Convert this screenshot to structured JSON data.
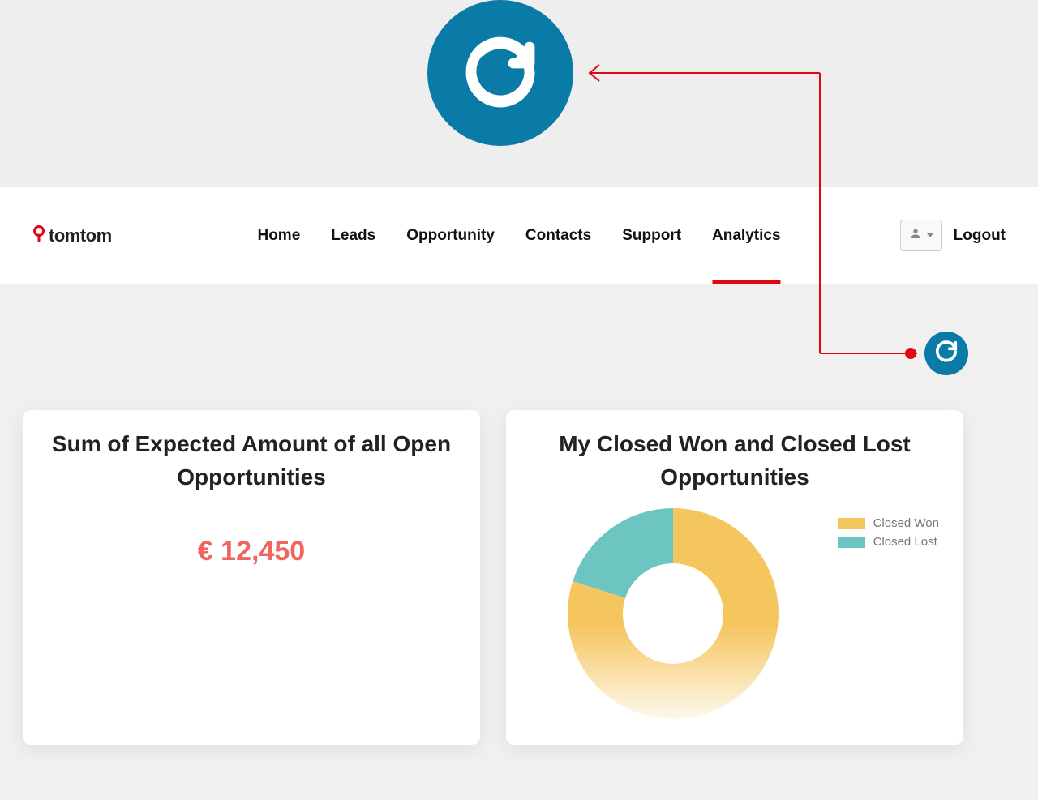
{
  "brand": {
    "name": "tomtom"
  },
  "nav": {
    "items": [
      {
        "label": "Home"
      },
      {
        "label": "Leads"
      },
      {
        "label": "Opportunity"
      },
      {
        "label": "Contacts"
      },
      {
        "label": "Support"
      },
      {
        "label": "Analytics"
      }
    ],
    "active_index": 5,
    "logout": "Logout"
  },
  "colors": {
    "accent_blue": "#0a7aa6",
    "accent_red": "#e20613",
    "amount_red": "#f0655d",
    "won_yellow": "#f5c55e",
    "lost_teal": "#6cc5c0"
  },
  "cards": {
    "sum_expected": {
      "title": "Sum of Expected Amount of all Open Opportunities",
      "value": "€ 12,450"
    },
    "closed_chart": {
      "title": "My Closed Won and Closed Lost Opportunities"
    }
  },
  "chart_data": {
    "type": "pie",
    "title": "My Closed Won and Closed Lost Opportunities",
    "series": [
      {
        "name": "Closed Won",
        "value": 80,
        "color": "#f5c55e"
      },
      {
        "name": "Closed Lost",
        "value": 20,
        "color": "#6cc5c0"
      }
    ],
    "legend_position": "right",
    "donut": true
  }
}
